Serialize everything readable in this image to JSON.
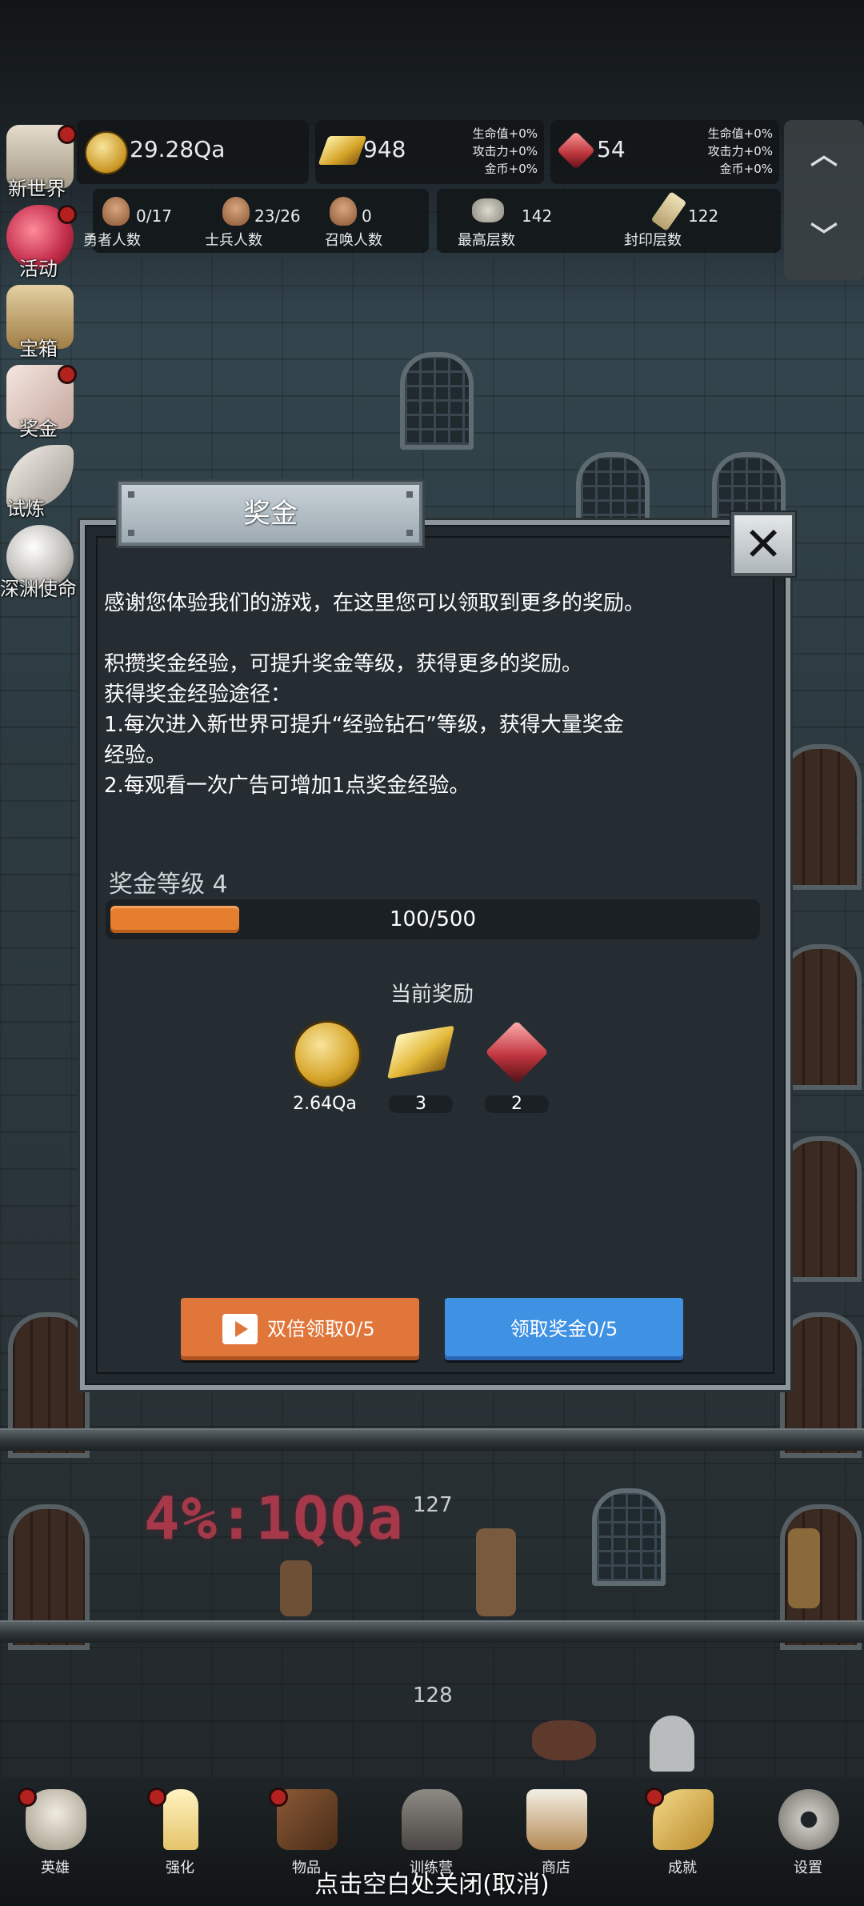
{
  "resources": {
    "gold": "29.28Qa",
    "gold_bars": "948",
    "gems": "54",
    "gold_bar_bonus": [
      "生命值+0%",
      "攻击力+0%",
      "金币+0%"
    ],
    "gem_bonus": [
      "生命值+0%",
      "攻击力+0%",
      "金币+0%"
    ]
  },
  "counters": [
    {
      "value": "0/17",
      "label": "勇者人数",
      "icon": "hero-head-icon"
    },
    {
      "value": "23/26",
      "label": "士兵人数",
      "icon": "soldier-head-icon"
    },
    {
      "value": "0",
      "label": "召唤人数",
      "icon": "summon-head-icon"
    },
    {
      "value": "142",
      "label": "最高层数",
      "icon": "stone-icon"
    },
    {
      "value": "122",
      "label": "封印层数",
      "icon": "scroll-icon"
    }
  ],
  "side_menu": [
    {
      "label": "新世界",
      "icon": "castle-icon"
    },
    {
      "label": "活动",
      "icon": "heart-icon"
    },
    {
      "label": "宝箱",
      "icon": "chest-icon"
    },
    {
      "label": "奖金",
      "icon": "envelope-icon"
    },
    {
      "label": "试炼",
      "icon": "feather-icon"
    },
    {
      "label": "深渊使命",
      "icon": "orb-icon"
    }
  ],
  "floors": [
    "127",
    "128"
  ],
  "overlay_text": "4%:1QQa",
  "dialog": {
    "title": "奖金",
    "description": "感谢您体验我们的游戏，在这里您可以领取到更多的奖励。\n\n积攒奖金经验，可提升奖金等级，获得更多的奖励。\n获得奖金经验途径：\n1.每次进入新世界可提升“经验钻石”等级，获得大量奖金\n经验。\n2.每观看一次广告可增加1点奖金经验。",
    "level_label": "奖金等级 4",
    "progress_text": "100/500",
    "progress_fraction": 0.2,
    "current_rewards_label": "当前奖励",
    "rewards": [
      {
        "amount": "2.64Qa",
        "icon": "gold-coin-icon"
      },
      {
        "amount": "3",
        "icon": "gold-bar-icon"
      },
      {
        "amount": "2",
        "icon": "red-gem-icon"
      }
    ],
    "double_claim_label": "双倍领取0/5",
    "claim_label": "领取奖金0/5"
  },
  "bottom_nav": [
    {
      "label": "英雄",
      "icon": "skull-icon",
      "badge": true
    },
    {
      "label": "强化",
      "icon": "candle-icon",
      "badge": true
    },
    {
      "label": "物品",
      "icon": "book-icon",
      "badge": true
    },
    {
      "label": "训练营",
      "icon": "lantern-icon",
      "badge": false
    },
    {
      "label": "商店",
      "icon": "mug-icon",
      "badge": false
    },
    {
      "label": "成就",
      "icon": "key-icon",
      "badge": true
    },
    {
      "label": "设置",
      "icon": "gear-icon",
      "badge": false
    }
  ],
  "close_hint": "点击空白处关闭(取消)",
  "colors": {
    "progress_fill": "#e67e2f",
    "double_claim_button": "#e0763a",
    "claim_button": "#3f91e4",
    "badge": "#b3221f"
  }
}
